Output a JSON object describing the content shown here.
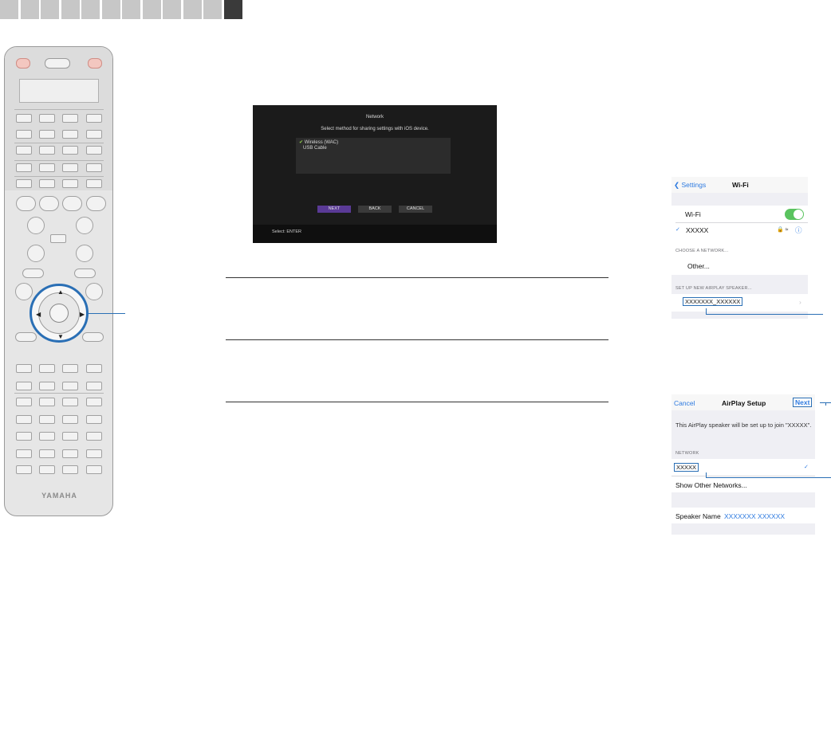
{
  "tabs": {
    "count": 12,
    "active_index": 11
  },
  "remote": {
    "brand": "YAMAHA"
  },
  "tv": {
    "title": "Network",
    "prompt": "Select method for sharing settings with iOS device.",
    "options": [
      {
        "label": "Wireless (WAC)",
        "checked": true
      },
      {
        "label": "USB Cable",
        "checked": false
      }
    ],
    "buttons": [
      "NEXT",
      "BACK",
      "CANCEL"
    ],
    "selected_button": "NEXT",
    "footer": "Select: ENTER"
  },
  "wifi_screen": {
    "back_label": "Settings",
    "title": "Wi-Fi",
    "wifi_label": "Wi-Fi",
    "wifi_on": true,
    "connected_network": "XXXXX",
    "section_choose": "CHOOSE A NETWORK...",
    "other_label": "Other...",
    "section_airplay": "SET UP NEW AIRPLAY SPEAKER...",
    "speaker_item": "XXXXXXX_XXXXXX"
  },
  "airplay_screen": {
    "cancel_label": "Cancel",
    "title": "AirPlay Setup",
    "next_label": "Next",
    "message": "This AirPlay speaker will be set up to join \"XXXXX\".",
    "section_network": "NETWORK",
    "network_value": "XXXXX",
    "show_other": "Show Other Networks...",
    "speaker_name_label": "Speaker Name",
    "speaker_name_value": "XXXXXXX XXXXXX"
  },
  "colors": {
    "accent": "#2a6fb5",
    "ios_blue": "#2d7ae0",
    "toggle_green": "#5ac35f",
    "tv_select": "#5a3a96"
  }
}
